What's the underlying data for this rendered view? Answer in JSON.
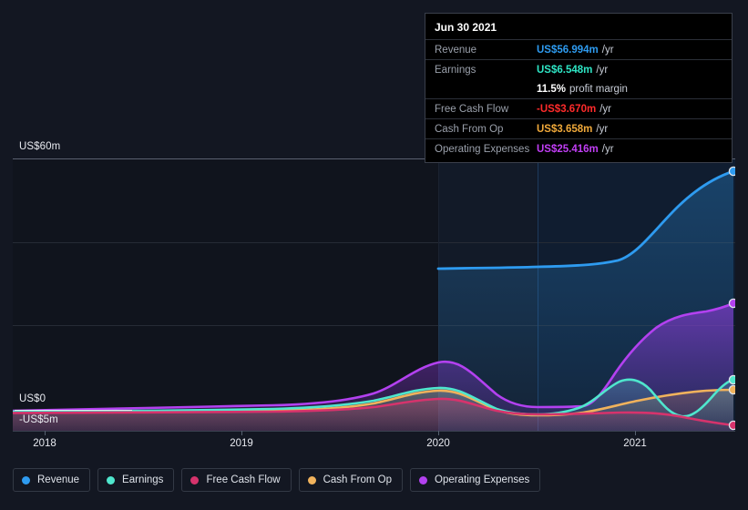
{
  "tooltip": {
    "title": "Jun 30 2021",
    "rows": [
      {
        "key": "Revenue",
        "value": "US$56.994m",
        "unit": "/yr",
        "color": "#2e9bf0"
      },
      {
        "key": "Earnings",
        "value": "US$6.548m",
        "unit": "/yr",
        "color": "#2ee6c5"
      },
      {
        "key": "Free Cash Flow",
        "value": "-US$3.670m",
        "unit": "/yr",
        "color": "#ff2b2b"
      },
      {
        "key": "Cash From Op",
        "value": "US$3.658m",
        "unit": "/yr",
        "color": "#f0a93a"
      },
      {
        "key": "Operating Expenses",
        "value": "US$25.416m",
        "unit": "/yr",
        "color": "#c13ef5"
      }
    ],
    "margin_value": "11.5%",
    "margin_label": "profit margin"
  },
  "axes": {
    "y_labels": [
      "US$60m",
      "US$0",
      "-US$5m"
    ],
    "x_labels": [
      "2018",
      "2019",
      "2020",
      "2021"
    ]
  },
  "legend": [
    {
      "label": "Revenue",
      "color": "#2e9bf0"
    },
    {
      "label": "Earnings",
      "color": "#4fe6cd"
    },
    {
      "label": "Free Cash Flow",
      "color": "#d6336c"
    },
    {
      "label": "Cash From Op",
      "color": "#f0b25c"
    },
    {
      "label": "Operating Expenses",
      "color": "#b341f0"
    }
  ],
  "chart_data": {
    "type": "line",
    "title": "",
    "xlabel": "",
    "ylabel": "US$m",
    "ylim": [
      -5,
      60
    ],
    "grid": true,
    "legend_position": "bottom",
    "x": [
      "2018",
      "2018.5",
      "2019",
      "2019.5",
      "2020",
      "2020.5",
      "2021",
      "2021.5"
    ],
    "x_tick_labels": [
      "2018",
      "2019",
      "2020",
      "2021"
    ],
    "gridline_values": [
      60,
      40,
      20,
      0
    ],
    "series": [
      {
        "name": "Revenue",
        "color": "#2e9bf0",
        "values": [
          null,
          null,
          null,
          null,
          34.0,
          34.2,
          35.5,
          56.994
        ],
        "note": "data begins at 2020; flat near US$34m then rises steeply to US$56.994m"
      },
      {
        "name": "Earnings",
        "color": "#4fe6cd",
        "values": [
          0.3,
          0.4,
          0.5,
          1.2,
          2.6,
          0.6,
          3.4,
          6.548
        ],
        "note": "small bump in 2020, dip mid-2021, ends at US$6.548m"
      },
      {
        "name": "Free Cash Flow",
        "color": "#d6336c",
        "values": [
          -0.3,
          -0.3,
          -0.3,
          0.3,
          1.4,
          -0.4,
          -1.0,
          -3.67
        ],
        "note": "declines through 2021 to -US$3.670m"
      },
      {
        "name": "Cash From Op",
        "color": "#f0b25c",
        "values": [
          -0.2,
          -0.2,
          -0.2,
          0.8,
          2.2,
          -0.5,
          2.4,
          3.658
        ],
        "note": "rises steadily across 2021 to US$3.658m"
      },
      {
        "name": "Operating Expenses",
        "color": "#b341f0",
        "values": [
          0.6,
          0.7,
          0.9,
          3.5,
          11.5,
          0.6,
          12.0,
          25.416
        ],
        "note": "peak near mid-2020, then strong rise to US$25.416m"
      }
    ],
    "highlight_date": "Jun 30 2021"
  }
}
